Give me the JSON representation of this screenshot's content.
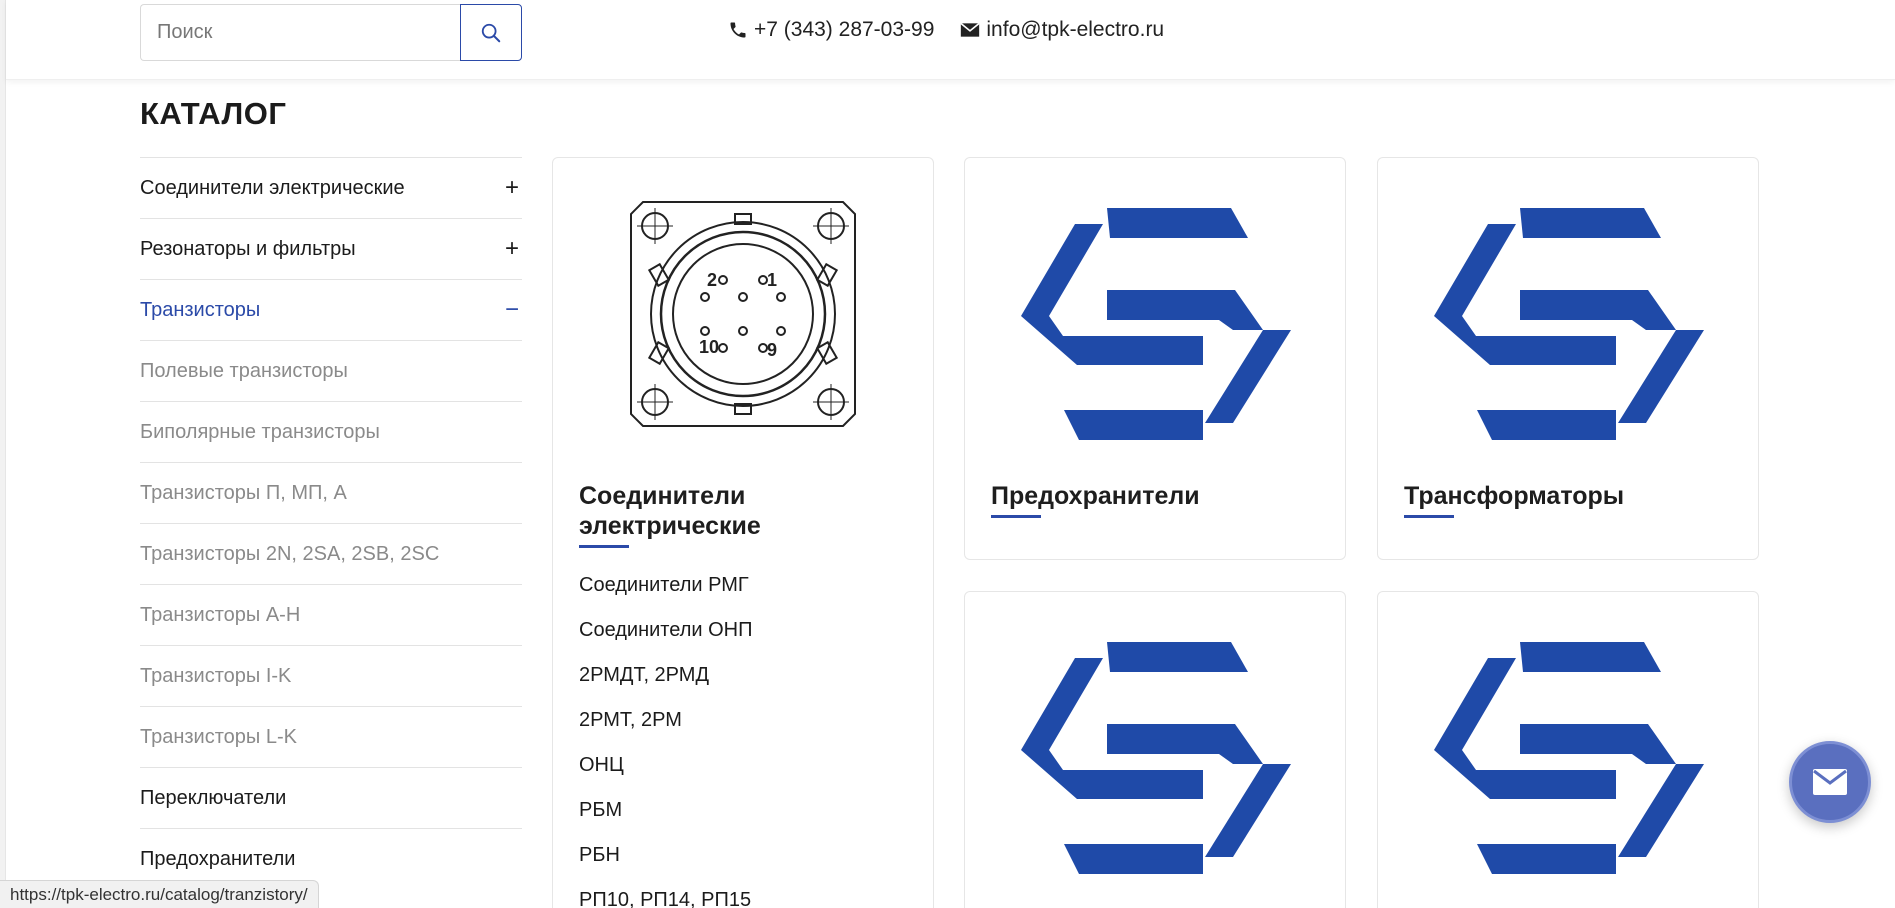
{
  "header": {
    "search_placeholder": "Поиск",
    "phone": "+7 (343) 287-03-99",
    "email": "info@tpk-electro.ru"
  },
  "catalog": {
    "title": "КАТАЛОГ"
  },
  "sidebar": {
    "items": [
      {
        "label": "Соединители электрические",
        "toggle": "+",
        "state": "collapsed"
      },
      {
        "label": "Резонаторы и фильтры",
        "toggle": "+",
        "state": "collapsed"
      },
      {
        "label": "Транзисторы",
        "toggle": "−",
        "state": "expanded"
      },
      {
        "label": "Полевые транзисторы"
      },
      {
        "label": "Биполярные транзисторы"
      },
      {
        "label": "Транзисторы П, МП, А"
      },
      {
        "label": "Транзисторы 2N, 2SA, 2SB, 2SC"
      },
      {
        "label": "Транзисторы A-H"
      },
      {
        "label": "Транзисторы I-K"
      },
      {
        "label": "Транзисторы L-K"
      },
      {
        "label": "Переключатели"
      },
      {
        "label": "Предохранители"
      }
    ]
  },
  "cards": [
    {
      "title": "Соединители электрические",
      "image_icon": "connector-drawing-icon",
      "connector_pins": [
        "2",
        "1",
        "10",
        "9"
      ],
      "subitems": [
        "Соединители РМГ",
        "Соединители ОНП",
        "2РМДТ, 2РМД",
        "2РМТ, 2РМ",
        "ОНЦ",
        "РБМ",
        "РБН",
        "РП10, РП14, РП15"
      ]
    },
    {
      "title": "Предохранители",
      "image_icon": "company-logo-icon"
    },
    {
      "title": "Трансформаторы",
      "image_icon": "company-logo-icon"
    },
    {
      "title": "",
      "image_icon": "company-logo-icon"
    },
    {
      "title": "",
      "image_icon": "company-logo-icon"
    }
  ],
  "status_bar": {
    "url": "https://tpk-electro.ru/catalog/tranzistory/"
  },
  "fab": {
    "icon": "mail-icon"
  },
  "colors": {
    "accent": "#2b4aa8",
    "logo_blue": "#1f4aa8",
    "muted_text": "#8a8a8a",
    "fab": "#5a6fbf"
  }
}
